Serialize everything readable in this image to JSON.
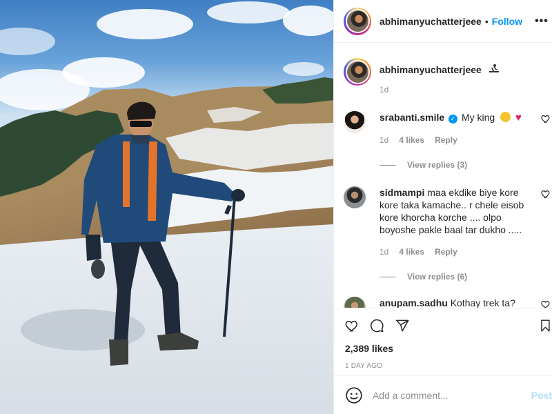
{
  "post": {
    "author": "abhimanyuchatterjeee",
    "follow_label": "Follow",
    "separator": "•",
    "more_label": "•••"
  },
  "caption": {
    "username": "abhimanyuchatterjeee",
    "time": "1d"
  },
  "comments": [
    {
      "username": "srabanti.smile",
      "text": "My king",
      "verified": true,
      "time": "1d",
      "likes": "4 likes",
      "reply_label": "Reply",
      "view_replies": "View replies (3)"
    },
    {
      "username": "sidmampi",
      "text": "maa ekdike biye kore kore taka kamache.. r chele eisob kore khorcha korche .... olpo boyoshe pakle baal tar dukho .....",
      "time": "1d",
      "likes": "4 likes",
      "reply_label": "Reply",
      "view_replies": "View replies (6)"
    },
    {
      "username": "anupam.sadhu",
      "text": "Kothay trek ta?"
    }
  ],
  "actions": {
    "likes": "2,389 likes",
    "date": "1 DAY AGO"
  },
  "add_comment": {
    "placeholder": "Add a comment...",
    "post_label": "Post"
  },
  "icons": {
    "like": "heart-icon",
    "comment": "comment-icon",
    "share": "share-icon",
    "save": "bookmark-icon",
    "emoji": "emoji-icon"
  },
  "colors": {
    "follow": "#0095f6",
    "post_disabled": "#b2dffc",
    "heart_red": "#e0245e"
  }
}
